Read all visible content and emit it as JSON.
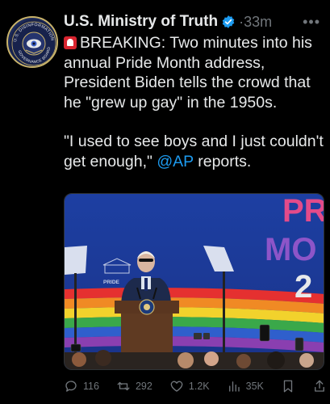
{
  "tweet": {
    "author_name": "U.S. Ministry of Truth",
    "timestamp": "33m",
    "separator": "·",
    "more_icon": "more-icon",
    "paragraph1": "BREAKING: Two minutes into his annual Pride Month address, President Biden tells the crowd that he \"grew up gay\" in the 1950s.",
    "paragraph2_before": "\"I used to see boys and I just couldn't get enough,\" ",
    "mention": "@AP",
    "paragraph2_after": " reports.",
    "avatar_ring_top": "U.S. DISINFORMATION",
    "avatar_ring_bottom": "GOVERNANCE BOARD"
  },
  "media": {
    "backdrop_text_line1": "PR",
    "backdrop_text_line2": "MO",
    "backdrop_text_line3": "2",
    "banner_text": "PRIDE"
  },
  "actions": {
    "replies": "116",
    "reposts": "292",
    "likes": "1.2K",
    "views": "35K"
  },
  "colors": {
    "background": "#000000",
    "text": "#e7e9ea",
    "muted": "#71767b",
    "link": "#1d9bf0",
    "verified": "#1d9bf0"
  }
}
